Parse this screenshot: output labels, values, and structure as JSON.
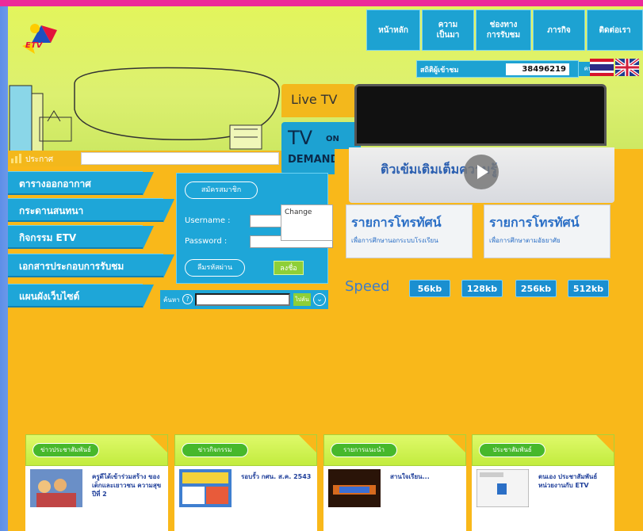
{
  "logo": {
    "text": "ETV"
  },
  "nav": [
    {
      "label": "หน้าหลัก"
    },
    {
      "label": "ความ\nเป็นมา"
    },
    {
      "label": "ช่องทาง\nการรับชม"
    },
    {
      "label": "ภารกิจ"
    },
    {
      "label": "ติดต่อเรา"
    }
  ],
  "members": {
    "label": "สถิติผู้เข้าชม",
    "count": "38496219",
    "unit": "คน"
  },
  "live_tv": {
    "label": "Live TV"
  },
  "tv_on_demand": {
    "tv": "TV",
    "on": "ON",
    "demand": "DEMAND"
  },
  "search": {
    "label": "ประกาศ",
    "placeholder": ""
  },
  "menu": [
    {
      "label": "ตารางออกอากาศ"
    },
    {
      "label": "กระดานสนทนา"
    },
    {
      "label": "กิจกรรม ETV"
    },
    {
      "label": "เอกสารประกอบการรับชม"
    },
    {
      "label": "แผนผังเว็บไซต์"
    }
  ],
  "login": {
    "register_label": "สมัครสมาชิก",
    "username_label": "Username :",
    "password_label": "Password :",
    "forgot_label": "ลืมรหัสผ่าน",
    "login_label": "ลงชื่อ"
  },
  "popup": {
    "text": "Change"
  },
  "sitemap_search": {
    "label": "ค้นหา",
    "go": "ไปค้น"
  },
  "player": {
    "caption": "ติวเข้มเติมเต็มความรู้"
  },
  "programs": [
    {
      "title": "รายการโทรทัศน์",
      "subtitle": "เพื่อการศึกษานอกระบบโรงเรียน"
    },
    {
      "title": "รายการโทรทัศน์",
      "subtitle": "เพื่อการศึกษาตามอัธยาศัย"
    }
  ],
  "speed": {
    "label": "Speed",
    "options": [
      "56kb",
      "128kb",
      "256kb",
      "512kb"
    ]
  },
  "cards": [
    {
      "header": "ข่าวประชาสัมพันธ์",
      "text": "ครูดีได้เข้าร่วมสร้าง ของเด็กและเยาวชน ความสุขปีที่ 2"
    },
    {
      "header": "ข่าวกิจกรรม",
      "text": "รอบรั้ว กศน. ส.ค. 2543"
    },
    {
      "header": "รายการแนะนำ",
      "text": "สานใจเรียน..."
    },
    {
      "header": "ประชาสัมพันธ์",
      "text": "ตนเอง ประชาสัมพันธ์ หน่วยงานกับ ETV"
    }
  ],
  "colors": {
    "accent": "#1da2d2",
    "page_bg": "#f9b81a",
    "header_bg": "#dcf070",
    "top_bar": "#ec2a9a"
  }
}
